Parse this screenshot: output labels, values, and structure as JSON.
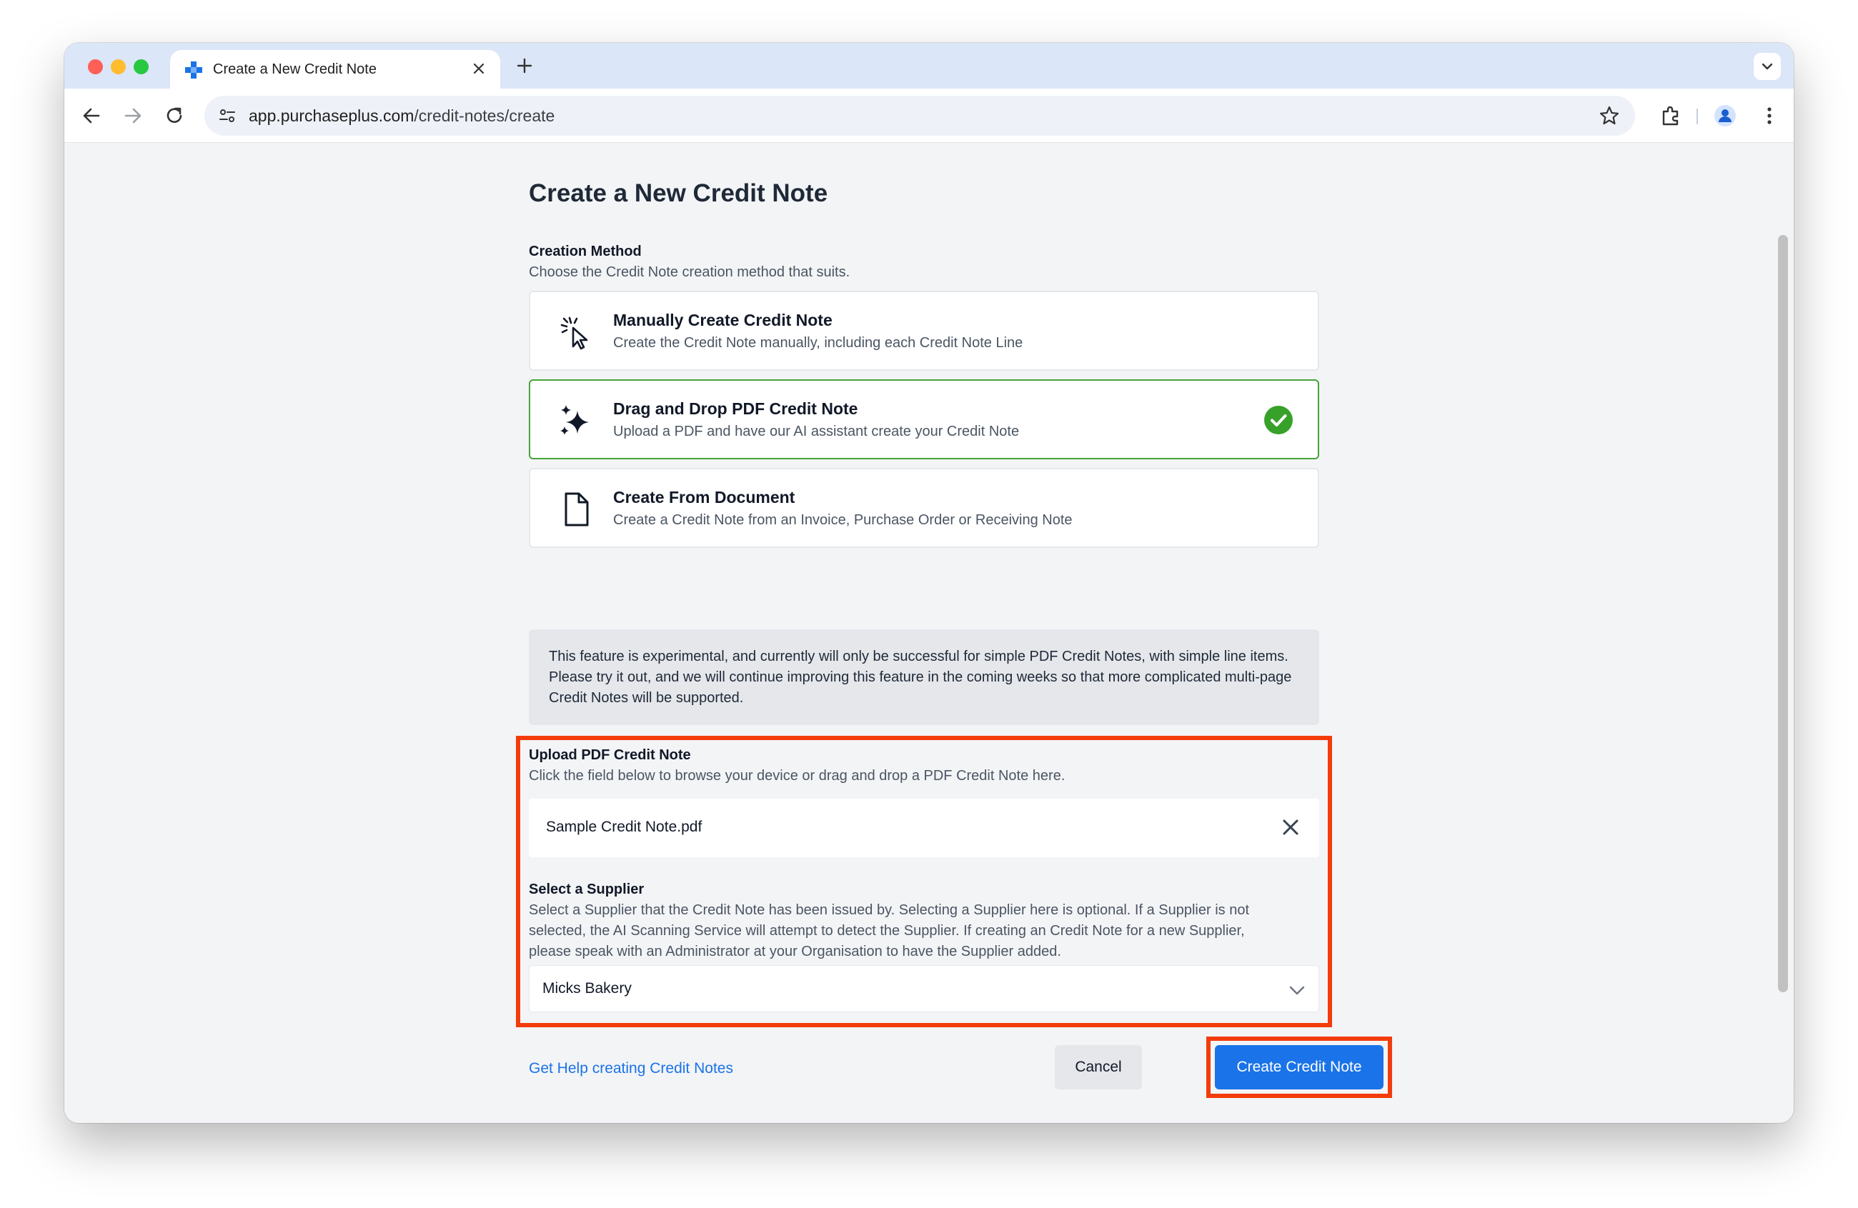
{
  "browser": {
    "tab_title": "Create a New Credit Note",
    "url_host": "app.purchaseplus.com",
    "url_path": "/credit-notes/create"
  },
  "page": {
    "title": "Create a New Credit Note"
  },
  "creation_method": {
    "label": "Creation Method",
    "description": "Choose the Credit Note creation method that suits.",
    "options": [
      {
        "title": "Manually Create Credit Note",
        "description": "Create the Credit Note manually, including each Credit Note Line",
        "icon": "cursor-click-icon",
        "selected": false
      },
      {
        "title": "Drag and Drop PDF Credit Note",
        "description": "Upload a PDF and have our AI assistant create your Credit Note",
        "icon": "sparkles-icon",
        "selected": true
      },
      {
        "title": "Create From Document",
        "description": "Create a Credit Note from an Invoice, Purchase Order or Receiving Note",
        "icon": "document-icon",
        "selected": false
      }
    ]
  },
  "notice": {
    "text": "This feature is experimental, and currently will only be successful for simple PDF Credit Notes, with simple line items. Please try it out, and we will continue improving this feature in the coming weeks so that more complicated multi-page Credit Notes will be supported."
  },
  "upload": {
    "label": "Upload PDF Credit Note",
    "description": "Click the field below to browse your device or drag and drop a PDF Credit Note here.",
    "file_name": "Sample Credit Note.pdf"
  },
  "supplier": {
    "label": "Select a Supplier",
    "description_lines": [
      "Select a Supplier that the Credit Note has been issued by. Selecting a Supplier here is optional. If a Supplier is not",
      "selected, the AI Scanning Service will attempt to detect the Supplier. If creating an Credit Note for a new Supplier,",
      "please speak with an Administrator at your Organisation to have the Supplier added."
    ],
    "selected_value": "Micks Bakery"
  },
  "footer": {
    "help_link": "Get Help creating Credit Notes",
    "cancel_label": "Cancel",
    "submit_label": "Create Credit Note"
  },
  "colors": {
    "accent": "#1a73e8",
    "selected_border": "#46a33a",
    "highlight": "#f33c0b"
  }
}
